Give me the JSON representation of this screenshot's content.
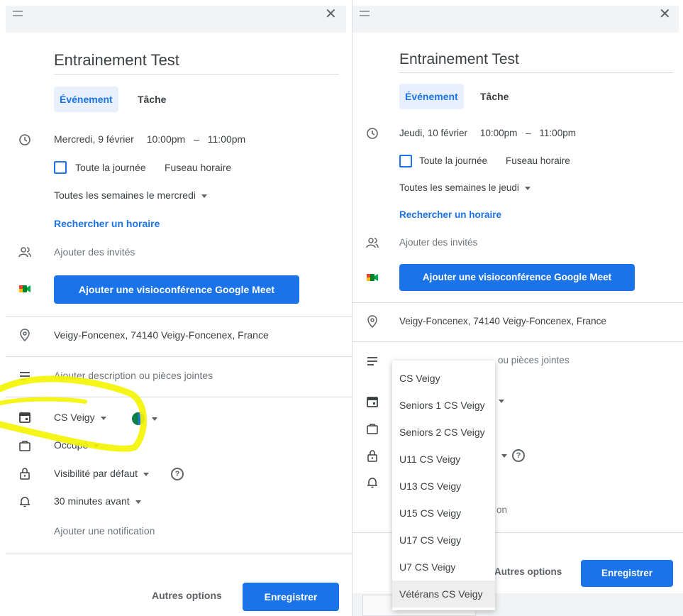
{
  "left": {
    "title": "Entrainement Test",
    "tabs": [
      {
        "label": "Événement",
        "active": true
      },
      {
        "label": "Tâche",
        "active": false
      }
    ],
    "date": "Mercredi, 9 février",
    "time_start": "10:00pm",
    "time_sep": "–",
    "time_end": "11:00pm",
    "all_day_label": "Toute la journée",
    "timezone_label": "Fuseau horaire",
    "recurrence": "Toutes les semaines le mercredi",
    "find_time": "Rechercher un horaire",
    "guests_placeholder": "Ajouter des invités",
    "meet_button": "Ajouter une visioconférence Google Meet",
    "location": "Veigy-Foncenex, 74140 Veigy-Foncenex, France",
    "description_placeholder": "Ajouter description ou pièces jointes",
    "calendar": "CS Veigy",
    "status": "Occupé",
    "visibility": "Visibilité par défaut",
    "notification": "30 minutes avant",
    "add_notification": "Ajouter une notification",
    "more_options": "Autres options",
    "save": "Enregistrer"
  },
  "right": {
    "title": "Entrainement Test",
    "tabs": [
      {
        "label": "Événement",
        "active": true
      },
      {
        "label": "Tâche",
        "active": false
      }
    ],
    "date": "Jeudi, 10 février",
    "time_start": "10:00pm",
    "time_sep": "–",
    "time_end": "11:00pm",
    "all_day_label": "Toute la journée",
    "timezone_label": "Fuseau horaire",
    "recurrence": "Toutes les semaines le jeudi",
    "find_time": "Rechercher un horaire",
    "guests_placeholder": "Ajouter des invités",
    "meet_button": "Ajouter une visioconférence Google Meet",
    "location": "Veigy-Foncenex, 74140 Veigy-Foncenex, France",
    "description_placeholder_visible": "ou pièces jointes",
    "notification_partial": "on",
    "more_options": "Autres options",
    "save": "Enregistrer"
  },
  "calendar_dropdown": {
    "options": [
      "CS Veigy",
      "Seniors 1 CS Veigy",
      "Seniors 2 CS Veigy",
      "U11 CS Veigy",
      "U13 CS Veigy",
      "U15 CS Veigy",
      "U17 CS Veigy",
      "U7 CS Veigy",
      "Vétérans CS Veigy"
    ],
    "highlighted": "Vétérans CS Veigy"
  },
  "colors": {
    "accent": "#1a73e8",
    "annotation": "#f4f400",
    "meet_green": "#00832d",
    "meet_yellow": "#fbbc04",
    "meet_red": "#ea4335"
  },
  "icons": {
    "clock": "clock-icon",
    "people": "people-icon",
    "meet": "google-meet-icon",
    "location": "location-pin-icon",
    "description": "notes-icon",
    "calendar": "calendar-icon",
    "briefcase": "briefcase-icon",
    "lock": "lock-icon",
    "bell": "bell-icon",
    "close": "close-icon",
    "drag": "drag-handle-icon"
  }
}
